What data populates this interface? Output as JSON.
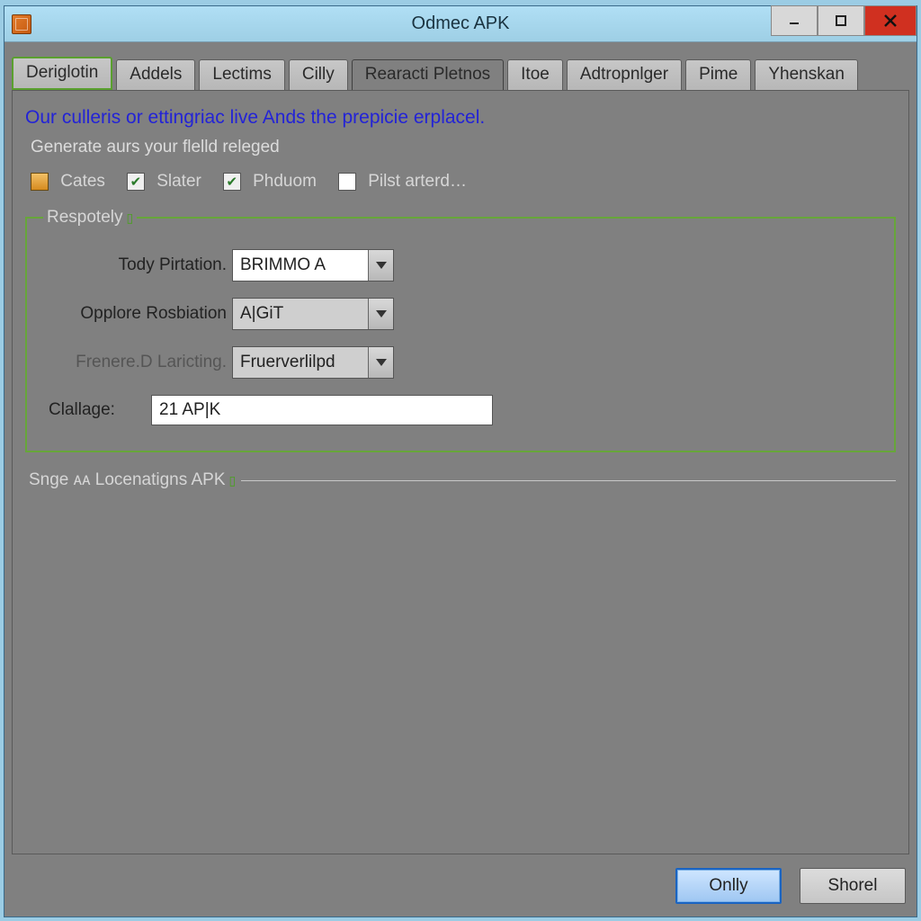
{
  "window": {
    "title": "Odmec APK"
  },
  "tabs": [
    {
      "label": "Deriglotin"
    },
    {
      "label": "Addels"
    },
    {
      "label": "Lectims"
    },
    {
      "label": "Cilly"
    },
    {
      "label": "Rearacti Pletnos"
    },
    {
      "label": "Itoe"
    },
    {
      "label": "Adtropnlger"
    },
    {
      "label": "Pime"
    },
    {
      "label": "Yhenskan"
    }
  ],
  "heading": "Our culleris or ettingriac live Ands the prepicie erplacel.",
  "subheading": "Generate aurs your flelld releged",
  "checks": {
    "cates": "Cates",
    "slater": "Slater",
    "phduom": "Phduom",
    "pilst": "Pilst arterd…"
  },
  "fieldset1": {
    "legend": "Respotely",
    "rows": {
      "tody": {
        "label": "Tody Pirtation.",
        "value": "BRIMMO A"
      },
      "opplore": {
        "label": "Opplore Rosbiation",
        "value": "A|GiT"
      },
      "frenere": {
        "label": "Frenere.D Laricting.",
        "value": "Fruerverlilpd"
      },
      "clallage": {
        "label": "Clallage:",
        "value": "21 AP|K"
      }
    }
  },
  "fieldset2": {
    "legend": "Snge ᴀᴀ Locenatigns APK"
  },
  "footer": {
    "primary": "Onlly",
    "secondary": "Shorel"
  }
}
